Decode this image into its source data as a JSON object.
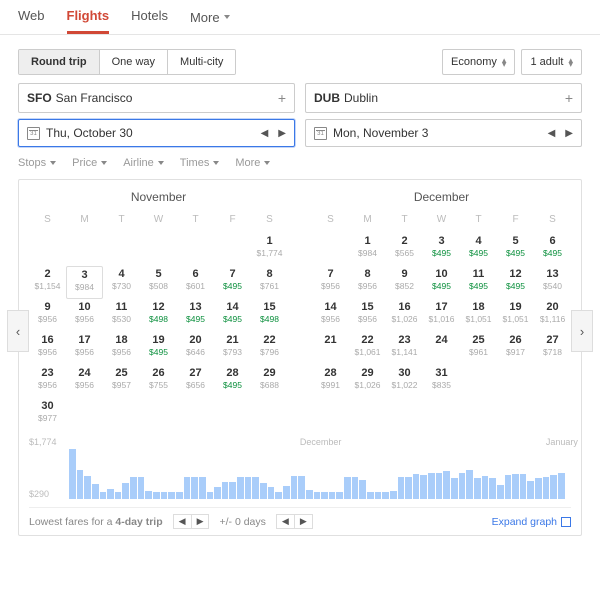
{
  "topnav": {
    "tabs": [
      "Web",
      "Flights",
      "Hotels",
      "More"
    ],
    "active": "Flights"
  },
  "trip_type": {
    "options": [
      "Round trip",
      "One way",
      "Multi-city"
    ],
    "active": "Round trip"
  },
  "cabin_select": "Economy",
  "pax_select": "1 adult",
  "origin": {
    "code": "SFO",
    "name": "San Francisco"
  },
  "dest": {
    "code": "DUB",
    "name": "Dublin"
  },
  "depart": "Thu, October 30",
  "return": "Mon, November 3",
  "filters": [
    "Stops",
    "Price",
    "Airline",
    "Times",
    "More"
  ],
  "dow": [
    "S",
    "M",
    "T",
    "W",
    "T",
    "F",
    "S"
  ],
  "month1": {
    "name": "November",
    "offset": 6,
    "days": [
      {
        "d": 1,
        "p": "$1,774"
      },
      {
        "d": 2,
        "p": "$1,154"
      },
      {
        "d": 3,
        "p": "$984",
        "today": true
      },
      {
        "d": 4,
        "p": "$730"
      },
      {
        "d": 5,
        "p": "$508"
      },
      {
        "d": 6,
        "p": "$601"
      },
      {
        "d": 7,
        "p": "$495",
        "g": true
      },
      {
        "d": 8,
        "p": "$761"
      },
      {
        "d": 9,
        "p": "$956"
      },
      {
        "d": 10,
        "p": "$956"
      },
      {
        "d": 11,
        "p": "$530"
      },
      {
        "d": 12,
        "p": "$498",
        "g": true
      },
      {
        "d": 13,
        "p": "$495",
        "g": true
      },
      {
        "d": 14,
        "p": "$495",
        "g": true
      },
      {
        "d": 15,
        "p": "$498",
        "g": true
      },
      {
        "d": 16,
        "p": "$956"
      },
      {
        "d": 17,
        "p": "$956"
      },
      {
        "d": 18,
        "p": "$956"
      },
      {
        "d": 19,
        "p": "$495",
        "g": true
      },
      {
        "d": 20,
        "p": "$646"
      },
      {
        "d": 21,
        "p": "$793"
      },
      {
        "d": 22,
        "p": "$796"
      },
      {
        "d": 23,
        "p": "$956"
      },
      {
        "d": 24,
        "p": "$956"
      },
      {
        "d": 25,
        "p": "$957"
      },
      {
        "d": 26,
        "p": "$755"
      },
      {
        "d": 27,
        "p": "$656"
      },
      {
        "d": 28,
        "p": "$495",
        "g": true
      },
      {
        "d": 29,
        "p": "$688"
      },
      {
        "d": 30,
        "p": "$977"
      }
    ]
  },
  "month2": {
    "name": "December",
    "offset": 1,
    "days": [
      {
        "d": 1,
        "p": "$984"
      },
      {
        "d": 2,
        "p": "$565"
      },
      {
        "d": 3,
        "p": "$495",
        "g": true
      },
      {
        "d": 4,
        "p": "$495",
        "g": true
      },
      {
        "d": 5,
        "p": "$495",
        "g": true
      },
      {
        "d": 6,
        "p": "$495",
        "g": true
      },
      {
        "d": 7,
        "p": "$956"
      },
      {
        "d": 8,
        "p": "$956"
      },
      {
        "d": 9,
        "p": "$852"
      },
      {
        "d": 10,
        "p": "$495",
        "g": true
      },
      {
        "d": 11,
        "p": "$495",
        "g": true
      },
      {
        "d": 12,
        "p": "$495",
        "g": true
      },
      {
        "d": 13,
        "p": "$540"
      },
      {
        "d": 14,
        "p": "$956"
      },
      {
        "d": 15,
        "p": "$956"
      },
      {
        "d": 16,
        "p": "$1,026"
      },
      {
        "d": 17,
        "p": "$1,016"
      },
      {
        "d": 18,
        "p": "$1,051"
      },
      {
        "d": 19,
        "p": "$1,051"
      },
      {
        "d": 20,
        "p": "$1,116"
      },
      {
        "d": 21
      },
      {
        "d": 22,
        "p": "$1,061"
      },
      {
        "d": 23,
        "p": "$1,141"
      },
      {
        "d": 24
      },
      {
        "d": 25,
        "p": "$961"
      },
      {
        "d": 26,
        "p": "$917"
      },
      {
        "d": 27,
        "p": "$718"
      },
      {
        "d": 28,
        "p": "$991"
      },
      {
        "d": 29,
        "p": "$1,026"
      },
      {
        "d": 30,
        "p": "$1,022"
      },
      {
        "d": 31,
        "p": "$835"
      }
    ]
  },
  "chart_data": {
    "type": "bar",
    "title": "",
    "xlabel": "",
    "ylabel": "",
    "ylim": [
      290,
      1774
    ],
    "y_top_label": "$1,774",
    "y_bot_label": "$290",
    "x_markers": [
      {
        "label": "December",
        "pos": 46
      },
      {
        "label": "January",
        "pos": 95
      }
    ],
    "values": [
      1774,
      1154,
      984,
      730,
      508,
      601,
      495,
      761,
      956,
      956,
      530,
      498,
      495,
      495,
      498,
      956,
      956,
      956,
      495,
      646,
      793,
      796,
      956,
      956,
      957,
      755,
      656,
      495,
      688,
      977,
      984,
      565,
      495,
      495,
      495,
      495,
      956,
      956,
      852,
      495,
      495,
      495,
      540,
      956,
      956,
      1026,
      1016,
      1051,
      1051,
      1116,
      900,
      1061,
      1141,
      900,
      961,
      917,
      718,
      991,
      1026,
      1022,
      835,
      900,
      950,
      1000,
      1050
    ]
  },
  "footer": {
    "lowest": "Lowest fares for a ",
    "trip_len": "4-day trip",
    "plusminus": "+/- 0 days",
    "expand": "Expand graph"
  }
}
